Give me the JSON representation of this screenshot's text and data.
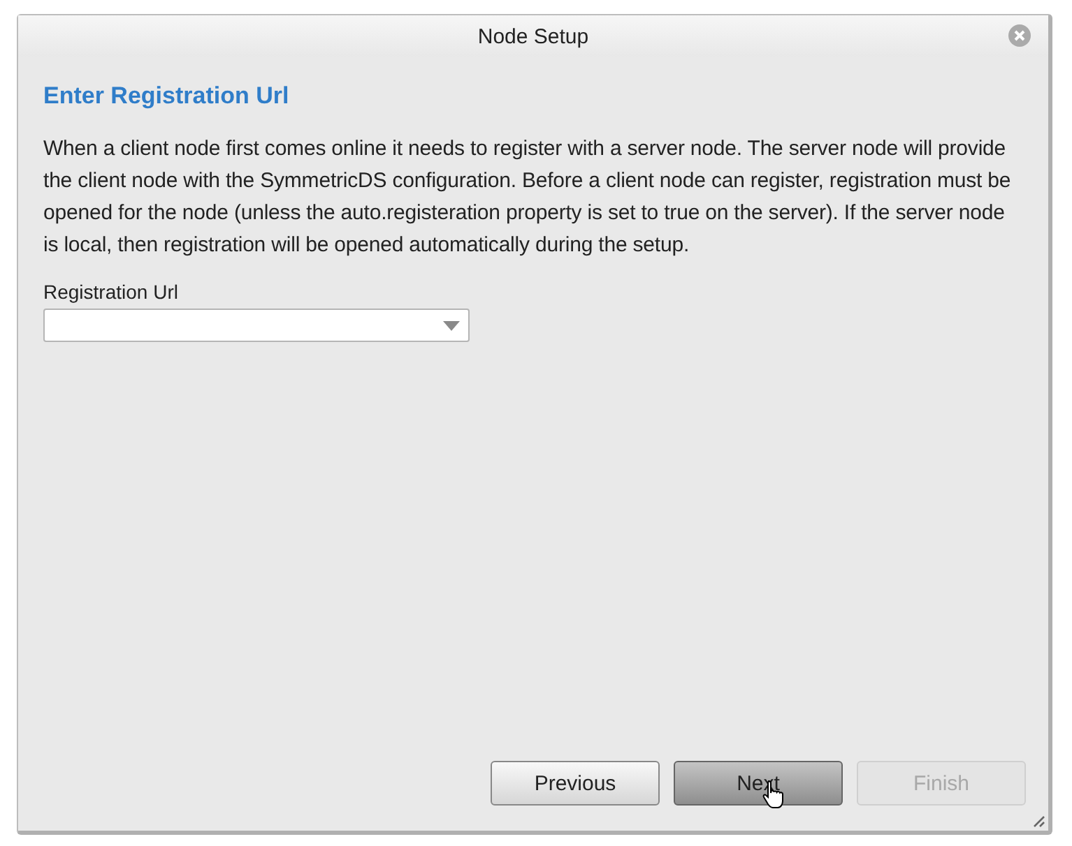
{
  "window": {
    "title": "Node Setup"
  },
  "heading": "Enter Registration Url",
  "description": "When a client node first comes online it needs to register with a server node. The server node will provide the client node with the SymmetricDS configuration. Before a client node can register, registration must be opened for the node (unless the auto.registeration property is set to true on the server). If the server node is local, then registration will be opened automatically during the setup.",
  "field": {
    "label": "Registration Url"
  },
  "buttons": [
    {
      "label": "Previous",
      "disabled": false,
      "hovered": false
    },
    {
      "label": "Next",
      "disabled": false,
      "hovered": true
    },
    {
      "label": "Finish",
      "disabled": true,
      "hovered": false
    }
  ]
}
